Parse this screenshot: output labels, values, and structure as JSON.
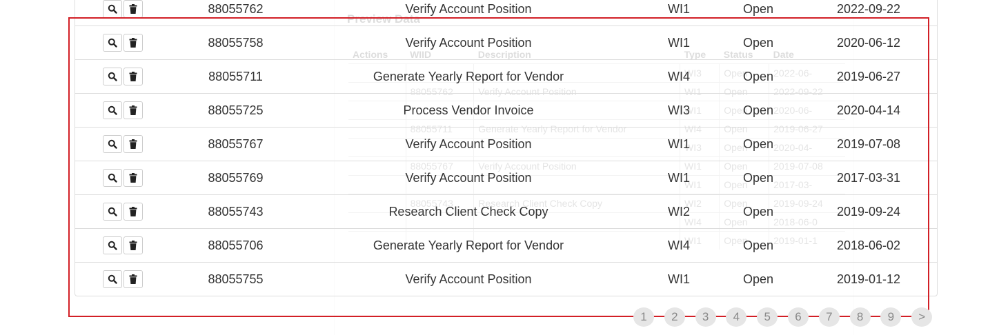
{
  "preview": {
    "title": "Preview Data",
    "headers": [
      "Actions",
      "WIID",
      "Description",
      "Type",
      "Status",
      "Date"
    ],
    "rows": [
      [
        "",
        "",
        "",
        "WI3",
        "Open",
        "2022-06-"
      ],
      [
        "",
        "88055762",
        "Verify Account Position",
        "WI1",
        "Open",
        "2022-09-22"
      ],
      [
        "",
        "",
        "",
        "WI1",
        "Open",
        "2020-06-"
      ],
      [
        "",
        "88055711",
        "Generate Yearly Report for Vendor",
        "WI4",
        "Open",
        "2019-06-27"
      ],
      [
        "",
        "",
        "",
        "WI3",
        "Open",
        "2020-04-"
      ],
      [
        "",
        "88055767",
        "Verify Account Position",
        "WI1",
        "Open",
        "2019-07-08"
      ],
      [
        "",
        "",
        "",
        "WI1",
        "Open",
        "2017-03-"
      ],
      [
        "",
        "88055743",
        "Research Client Check Copy",
        "WI2",
        "Open",
        "2019-09-24"
      ],
      [
        "",
        "",
        "",
        "WI4",
        "Open",
        "2018-06-0"
      ],
      [
        "",
        "",
        "",
        "WI1",
        "Open",
        "2019-01-1"
      ]
    ]
  },
  "table": {
    "rows": [
      {
        "id": "88055762",
        "description": "Verify Account Position",
        "type": "WI1",
        "status": "Open",
        "date": "2022-09-22"
      },
      {
        "id": "88055758",
        "description": "Verify Account Position",
        "type": "WI1",
        "status": "Open",
        "date": "2020-06-12"
      },
      {
        "id": "88055711",
        "description": "Generate Yearly Report for Vendor",
        "type": "WI4",
        "status": "Open",
        "date": "2019-06-27"
      },
      {
        "id": "88055725",
        "description": "Process Vendor Invoice",
        "type": "WI3",
        "status": "Open",
        "date": "2020-04-14"
      },
      {
        "id": "88055767",
        "description": "Verify Account Position",
        "type": "WI1",
        "status": "Open",
        "date": "2019-07-08"
      },
      {
        "id": "88055769",
        "description": "Verify Account Position",
        "type": "WI1",
        "status": "Open",
        "date": "2017-03-31"
      },
      {
        "id": "88055743",
        "description": "Research Client Check Copy",
        "type": "WI2",
        "status": "Open",
        "date": "2019-09-24"
      },
      {
        "id": "88055706",
        "description": "Generate Yearly Report for Vendor",
        "type": "WI4",
        "status": "Open",
        "date": "2018-06-02"
      },
      {
        "id": "88055755",
        "description": "Verify Account Position",
        "type": "WI1",
        "status": "Open",
        "date": "2019-01-12"
      }
    ],
    "action_icons": [
      "search-icon",
      "trash-icon"
    ]
  },
  "pagination": {
    "pages": [
      "1",
      "2",
      "3",
      "4",
      "5",
      "6",
      "7",
      "8",
      "9",
      ">"
    ]
  },
  "colors": {
    "highlight": "#d21f26",
    "border": "#dddddd",
    "pager_bg": "#e6e6e6"
  }
}
